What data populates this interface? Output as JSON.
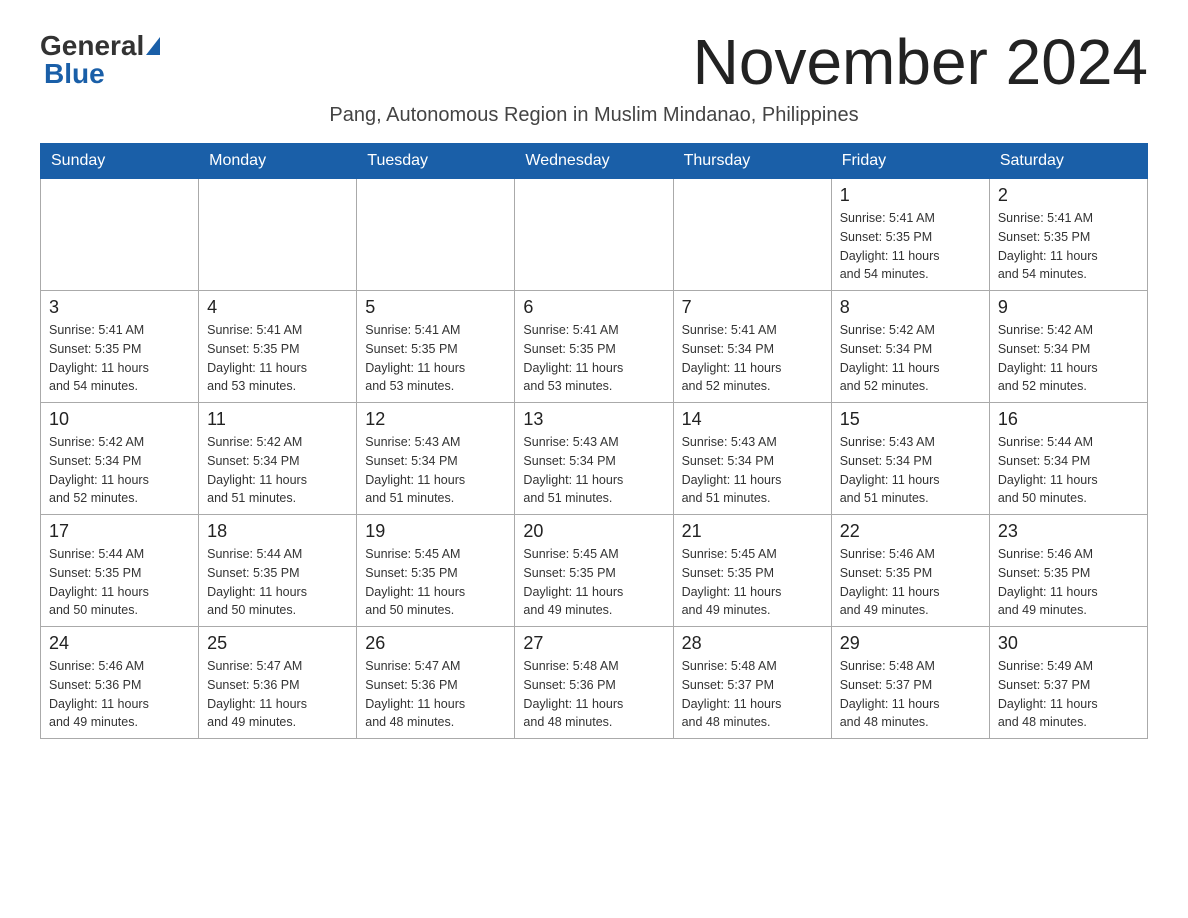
{
  "header": {
    "logo": {
      "general": "General",
      "blue": "Blue"
    },
    "month_title": "November 2024",
    "location": "Pang, Autonomous Region in Muslim Mindanao, Philippines"
  },
  "weekdays": [
    "Sunday",
    "Monday",
    "Tuesday",
    "Wednesday",
    "Thursday",
    "Friday",
    "Saturday"
  ],
  "weeks": [
    [
      {
        "day": "",
        "info": ""
      },
      {
        "day": "",
        "info": ""
      },
      {
        "day": "",
        "info": ""
      },
      {
        "day": "",
        "info": ""
      },
      {
        "day": "",
        "info": ""
      },
      {
        "day": "1",
        "info": "Sunrise: 5:41 AM\nSunset: 5:35 PM\nDaylight: 11 hours\nand 54 minutes."
      },
      {
        "day": "2",
        "info": "Sunrise: 5:41 AM\nSunset: 5:35 PM\nDaylight: 11 hours\nand 54 minutes."
      }
    ],
    [
      {
        "day": "3",
        "info": "Sunrise: 5:41 AM\nSunset: 5:35 PM\nDaylight: 11 hours\nand 54 minutes."
      },
      {
        "day": "4",
        "info": "Sunrise: 5:41 AM\nSunset: 5:35 PM\nDaylight: 11 hours\nand 53 minutes."
      },
      {
        "day": "5",
        "info": "Sunrise: 5:41 AM\nSunset: 5:35 PM\nDaylight: 11 hours\nand 53 minutes."
      },
      {
        "day": "6",
        "info": "Sunrise: 5:41 AM\nSunset: 5:35 PM\nDaylight: 11 hours\nand 53 minutes."
      },
      {
        "day": "7",
        "info": "Sunrise: 5:41 AM\nSunset: 5:34 PM\nDaylight: 11 hours\nand 52 minutes."
      },
      {
        "day": "8",
        "info": "Sunrise: 5:42 AM\nSunset: 5:34 PM\nDaylight: 11 hours\nand 52 minutes."
      },
      {
        "day": "9",
        "info": "Sunrise: 5:42 AM\nSunset: 5:34 PM\nDaylight: 11 hours\nand 52 minutes."
      }
    ],
    [
      {
        "day": "10",
        "info": "Sunrise: 5:42 AM\nSunset: 5:34 PM\nDaylight: 11 hours\nand 52 minutes."
      },
      {
        "day": "11",
        "info": "Sunrise: 5:42 AM\nSunset: 5:34 PM\nDaylight: 11 hours\nand 51 minutes."
      },
      {
        "day": "12",
        "info": "Sunrise: 5:43 AM\nSunset: 5:34 PM\nDaylight: 11 hours\nand 51 minutes."
      },
      {
        "day": "13",
        "info": "Sunrise: 5:43 AM\nSunset: 5:34 PM\nDaylight: 11 hours\nand 51 minutes."
      },
      {
        "day": "14",
        "info": "Sunrise: 5:43 AM\nSunset: 5:34 PM\nDaylight: 11 hours\nand 51 minutes."
      },
      {
        "day": "15",
        "info": "Sunrise: 5:43 AM\nSunset: 5:34 PM\nDaylight: 11 hours\nand 51 minutes."
      },
      {
        "day": "16",
        "info": "Sunrise: 5:44 AM\nSunset: 5:34 PM\nDaylight: 11 hours\nand 50 minutes."
      }
    ],
    [
      {
        "day": "17",
        "info": "Sunrise: 5:44 AM\nSunset: 5:35 PM\nDaylight: 11 hours\nand 50 minutes."
      },
      {
        "day": "18",
        "info": "Sunrise: 5:44 AM\nSunset: 5:35 PM\nDaylight: 11 hours\nand 50 minutes."
      },
      {
        "day": "19",
        "info": "Sunrise: 5:45 AM\nSunset: 5:35 PM\nDaylight: 11 hours\nand 50 minutes."
      },
      {
        "day": "20",
        "info": "Sunrise: 5:45 AM\nSunset: 5:35 PM\nDaylight: 11 hours\nand 49 minutes."
      },
      {
        "day": "21",
        "info": "Sunrise: 5:45 AM\nSunset: 5:35 PM\nDaylight: 11 hours\nand 49 minutes."
      },
      {
        "day": "22",
        "info": "Sunrise: 5:46 AM\nSunset: 5:35 PM\nDaylight: 11 hours\nand 49 minutes."
      },
      {
        "day": "23",
        "info": "Sunrise: 5:46 AM\nSunset: 5:35 PM\nDaylight: 11 hours\nand 49 minutes."
      }
    ],
    [
      {
        "day": "24",
        "info": "Sunrise: 5:46 AM\nSunset: 5:36 PM\nDaylight: 11 hours\nand 49 minutes."
      },
      {
        "day": "25",
        "info": "Sunrise: 5:47 AM\nSunset: 5:36 PM\nDaylight: 11 hours\nand 49 minutes."
      },
      {
        "day": "26",
        "info": "Sunrise: 5:47 AM\nSunset: 5:36 PM\nDaylight: 11 hours\nand 48 minutes."
      },
      {
        "day": "27",
        "info": "Sunrise: 5:48 AM\nSunset: 5:36 PM\nDaylight: 11 hours\nand 48 minutes."
      },
      {
        "day": "28",
        "info": "Sunrise: 5:48 AM\nSunset: 5:37 PM\nDaylight: 11 hours\nand 48 minutes."
      },
      {
        "day": "29",
        "info": "Sunrise: 5:48 AM\nSunset: 5:37 PM\nDaylight: 11 hours\nand 48 minutes."
      },
      {
        "day": "30",
        "info": "Sunrise: 5:49 AM\nSunset: 5:37 PM\nDaylight: 11 hours\nand 48 minutes."
      }
    ]
  ]
}
